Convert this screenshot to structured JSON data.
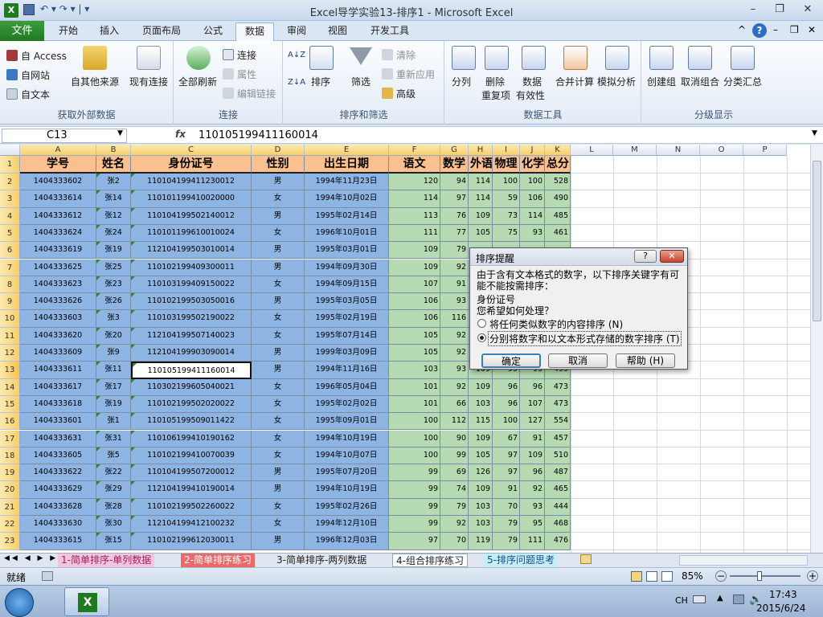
{
  "window": {
    "title": "Excel导学实验13-排序1  -  Microsoft Excel"
  },
  "quick_access": {
    "undo_redo": "↶ ▾ ↷ ▾ | ▾"
  },
  "window_buttons": {
    "minimize": "–",
    "restore": "❐",
    "close": "✕"
  },
  "menu_tabs": [
    "文件",
    "开始",
    "插入",
    "页面布局",
    "公式",
    "数据",
    "审阅",
    "视图",
    "开发工具"
  ],
  "active_tab": "数据",
  "ribbon": {
    "get_external": {
      "label": "获取外部数据",
      "access": "自 Access",
      "web": "自网站",
      "text": "自文本",
      "other": "自其他来源",
      "existing": "现有连接"
    },
    "connections": {
      "label": "连接",
      "refresh": "全部刷新",
      "connect": "连接",
      "props": "属性",
      "edit_links": "编辑链接"
    },
    "sort_filter": {
      "label": "排序和筛选",
      "sort": "排序",
      "filter": "筛选",
      "clear": "清除",
      "reapply": "重新应用",
      "advanced": "高级",
      "az": "A↓Z",
      "za": "Z↓A"
    },
    "data_tools": {
      "label": "数据工具",
      "split": "分列",
      "remove_dup_1": "删除",
      "remove_dup_2": "重复项",
      "validation_1": "数据",
      "validation_2": "有效性",
      "consolidate": "合并计算",
      "whatif": "模拟分析"
    },
    "outline": {
      "label": "分级显示",
      "group": "创建组",
      "ungroup": "取消组合",
      "subtotal": "分类汇总"
    }
  },
  "formula_bar": {
    "name_box": "C13",
    "fx": "fx",
    "value": "110105199411160014"
  },
  "columns": [
    "A",
    "B",
    "C",
    "D",
    "E",
    "F",
    "G",
    "H",
    "I",
    "J",
    "K",
    "L",
    "M",
    "N",
    "O",
    "P"
  ],
  "headers": [
    "学号",
    "姓名",
    "身份证号",
    "性别",
    "出生日期",
    "语文",
    "数学",
    "外语",
    "物理",
    "化学",
    "总分"
  ],
  "rows": [
    [
      "1404333602",
      "张2",
      "110104199411230012",
      "男",
      "1994年11月23日",
      "120",
      "94",
      "114",
      "100",
      "100",
      "528"
    ],
    [
      "1404333614",
      "张14",
      "110101199410020000",
      "女",
      "1994年10月02日",
      "114",
      "97",
      "114",
      "59",
      "106",
      "490"
    ],
    [
      "1404333612",
      "张12",
      "110104199502140012",
      "男",
      "1995年02月14日",
      "113",
      "76",
      "109",
      "73",
      "114",
      "485"
    ],
    [
      "1404333624",
      "张24",
      "110101199610010024",
      "女",
      "1996年10月01日",
      "111",
      "77",
      "105",
      "75",
      "93",
      "461"
    ],
    [
      "1404333619",
      "张19",
      "112104199503010014",
      "男",
      "1995年03月01日",
      "109",
      "79",
      "",
      "",
      "",
      ""
    ],
    [
      "1404333625",
      "张25",
      "110102199409300011",
      "男",
      "1994年09月30日",
      "109",
      "92",
      "",
      "",
      "",
      ""
    ],
    [
      "1404333623",
      "张23",
      "110103199409150022",
      "女",
      "1994年09月15日",
      "107",
      "91",
      "",
      "",
      "",
      ""
    ],
    [
      "1404333626",
      "张26",
      "110102199503050016",
      "男",
      "1995年03月05日",
      "106",
      "93",
      "",
      "",
      "",
      ""
    ],
    [
      "1404333603",
      "张3",
      "110103199502190022",
      "女",
      "1995年02月19日",
      "106",
      "116",
      "",
      "",
      "",
      ""
    ],
    [
      "1404333620",
      "张20",
      "112104199507140023",
      "女",
      "1995年07月14日",
      "105",
      "92",
      "",
      "",
      "",
      ""
    ],
    [
      "1404333609",
      "张9",
      "112104199903090014",
      "男",
      "1999年03月09日",
      "105",
      "92",
      "",
      "",
      "",
      ""
    ],
    [
      "1404333611",
      "张11",
      "110105199411160014",
      "男",
      "1994年11月16日",
      "103",
      "93",
      "109",
      "95",
      "95",
      "495"
    ],
    [
      "1404333617",
      "张17",
      "110302199605040021",
      "女",
      "1996年05月04日",
      "101",
      "92",
      "109",
      "96",
      "96",
      "473"
    ],
    [
      "1404333618",
      "张19",
      "110102199502020022",
      "女",
      "1995年02月02日",
      "101",
      "66",
      "103",
      "96",
      "107",
      "473"
    ],
    [
      "1404333601",
      "张1",
      "110105199509011422",
      "女",
      "1995年09月01日",
      "100",
      "112",
      "115",
      "100",
      "127",
      "554"
    ],
    [
      "1404333631",
      "张31",
      "110106199410190162",
      "女",
      "1994年10月19日",
      "100",
      "90",
      "109",
      "67",
      "91",
      "457"
    ],
    [
      "1404333605",
      "张5",
      "110102199410070039",
      "女",
      "1994年10月07日",
      "100",
      "99",
      "105",
      "97",
      "109",
      "510"
    ],
    [
      "1404333622",
      "张22",
      "110104199507200012",
      "男",
      "1995年07月20日",
      "99",
      "69",
      "126",
      "97",
      "96",
      "487"
    ],
    [
      "1404333629",
      "张29",
      "112104199410190014",
      "男",
      "1994年10月19日",
      "99",
      "74",
      "109",
      "91",
      "92",
      "465"
    ],
    [
      "1404333628",
      "张28",
      "110102199502260022",
      "女",
      "1995年02月26日",
      "99",
      "79",
      "103",
      "70",
      "93",
      "444"
    ],
    [
      "1404333630",
      "张30",
      "112104199412100232",
      "女",
      "1994年12月10日",
      "99",
      "92",
      "103",
      "79",
      "95",
      "468"
    ],
    [
      "1404333615",
      "张15",
      "110102199612030011",
      "男",
      "1996年12月03日",
      "97",
      "70",
      "119",
      "79",
      "111",
      "476"
    ]
  ],
  "selected_cell": "C13",
  "sheet_tabs": [
    "1-简单排序-单列数据",
    "2-简单排序练习",
    "3-简单排序-两列数据",
    "4-组合排序练习",
    "5-排序问题思考"
  ],
  "active_sheet": "4-组合排序练习",
  "status": {
    "mode": "就绪",
    "zoom": "85%"
  },
  "taskbar": {
    "ime": "CH",
    "time": "17:43",
    "date": "2015/6/24"
  },
  "dialog": {
    "title": "排序提醒",
    "message": "由于含有文本格式的数字，以下排序关键字有可能不能按需排序：",
    "key": "身份证号",
    "question": "您希望如何处理？",
    "option1": "将任何类似数字的内容排序 (N)",
    "option2": "分别将数字和以文本形式存储的数字排序 (T)",
    "selected_option": 2,
    "ok": "确定",
    "cancel": "取消",
    "help": "帮助 (H)",
    "help_btn": "?",
    "close_btn": "✕"
  },
  "colors": {
    "header_orange": "#fac090",
    "blue_block": "#8db4e2",
    "green_block": "#b6dbb3",
    "file_tab_green": "#2c8c2f",
    "row_hdr_yellow": "#f7d77a"
  }
}
